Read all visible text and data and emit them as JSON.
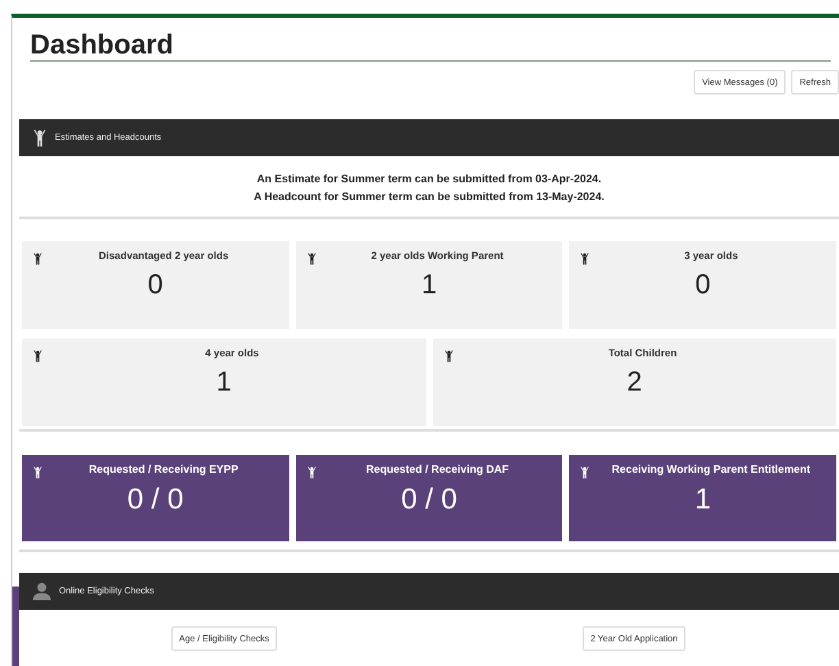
{
  "title": "Dashboard",
  "actions": [
    {
      "label": "View Messages (0)"
    },
    {
      "label": "Refresh"
    }
  ],
  "estimates": {
    "title": "Estimates and Headcounts",
    "notices": [
      "An Estimate for Summer term can be submitted from 03-Apr-2024.",
      "A Headcount for Summer term can be submitted from 13-May-2024."
    ],
    "tile_rows": [
      [
        {
          "label": "Disadvantaged 2 year olds",
          "value": "0"
        },
        {
          "label": "2 year olds Working Parent",
          "value": "1"
        },
        {
          "label": "3 year olds",
          "value": "0"
        }
      ],
      [
        {
          "label": "4 year olds",
          "value": "1"
        },
        {
          "label": "Total Children",
          "value": "2"
        }
      ]
    ],
    "entitlement_tiles": [
      {
        "label": "Requested / Receiving EYPP",
        "value": "0 / 0"
      },
      {
        "label": "Requested / Receiving DAF",
        "value": "0 / 0"
      },
      {
        "label": "Receiving Working Parent Entitlement",
        "value": "1"
      }
    ]
  },
  "eligibility": {
    "title": "Online Eligibility Checks",
    "buttons": [
      {
        "label": "Age / Eligibility Checks"
      },
      {
        "label": "2 Year Old Application"
      }
    ]
  }
}
